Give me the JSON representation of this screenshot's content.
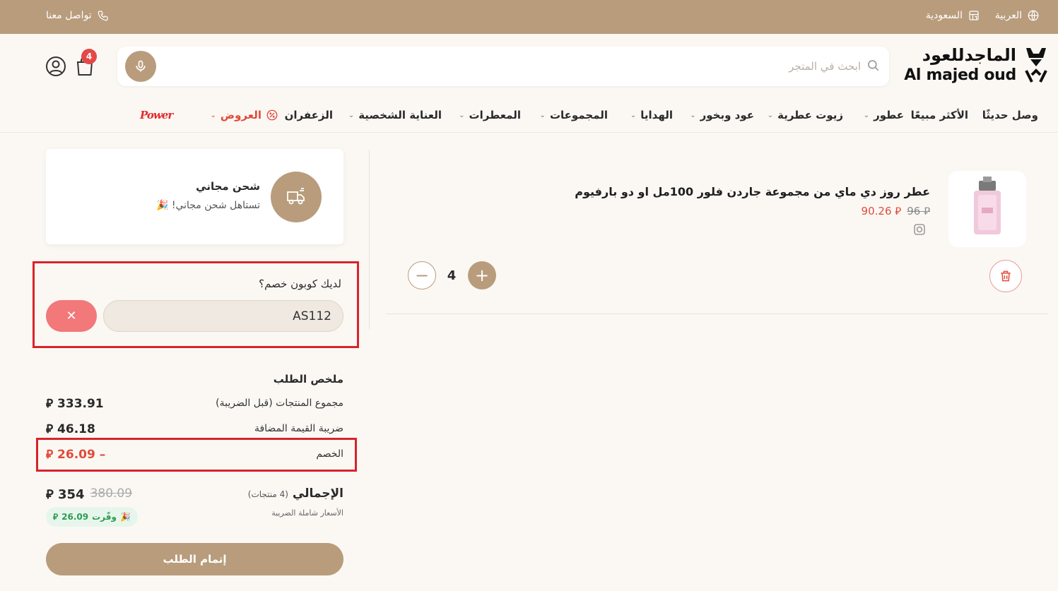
{
  "topbar": {
    "language": "العربية",
    "country": "السعودية",
    "contact": "تواصل معنا"
  },
  "header": {
    "logo_ar": "الماجدللعود",
    "logo_en": "Al majed oud",
    "search_placeholder": "ابحث في المتجر",
    "cart_count": "4"
  },
  "nav": {
    "items": [
      "وصل حديثًا",
      "الأكثر مبيعًا",
      "عطور",
      "زيوت عطرية",
      "عود وبخور",
      "الهدايا",
      "المجموعات",
      "المعطرات",
      "العناية الشخصية",
      "الزعفران",
      "العروض"
    ],
    "brand": "Power"
  },
  "cart_item": {
    "title": "عطر روز دي ماي من مجموعة جاردن فلور 100مل او دو بارفيوم",
    "old_price": "96",
    "new_price": "90.26",
    "quantity": "4"
  },
  "shipping": {
    "title": "شحن مجاني",
    "subtitle": "تستاهل شحن مجاني!"
  },
  "coupon": {
    "label": "لديك كوبون خصم؟",
    "code": "AS112",
    "remove_symbol": "✕"
  },
  "summary": {
    "title": "ملخص الطلب",
    "subtotal_label": "مجموع المنتجات (قبل الضريبة)",
    "subtotal_value": "333.91",
    "vat_label": "ضريبة القيمة المضافة",
    "vat_value": "46.18",
    "discount_label": "الخصم",
    "discount_value": "26.09 –",
    "total_label": "الإجمالي",
    "total_count": "(4 منتجات)",
    "total_old": "380.09",
    "total_new": "354",
    "tax_note": "الأسعار شاملة الضريبة",
    "saved_label": "وفّرت",
    "saved_value": "26.09",
    "checkout_label": "إتمام الطلب"
  },
  "currency_symbol": "⃁",
  "colors": {
    "brand": "#b89c7c",
    "accent_red": "#e24a3a",
    "highlight_red": "#d8232a",
    "saved_green": "#2e9b52"
  }
}
